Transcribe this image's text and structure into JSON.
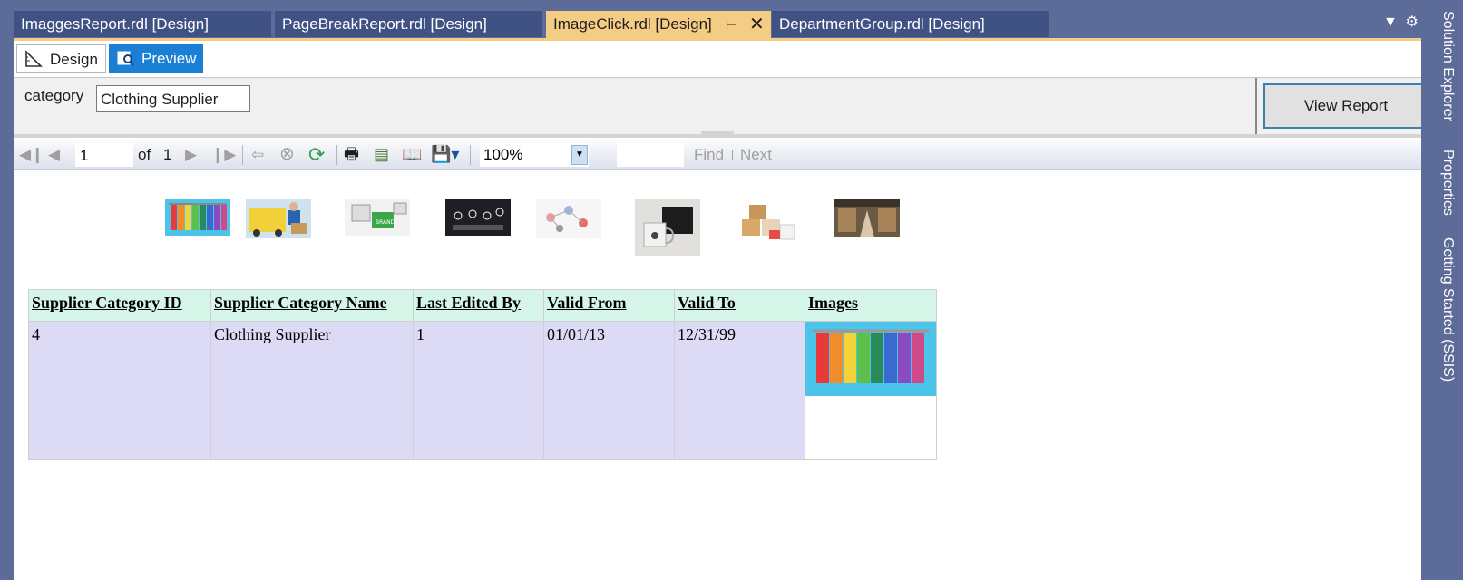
{
  "doc_tabs": [
    {
      "label": "ImaggesReport.rdl [Design]"
    },
    {
      "label": "PageBreakReport.rdl [Design]"
    },
    {
      "label": "ImageClick.rdl [Design]",
      "active": true
    },
    {
      "label": "DepartmentGroup.rdl [Design]"
    }
  ],
  "mode_tabs": {
    "design": "Design",
    "preview": "Preview"
  },
  "parameters": {
    "label": "category",
    "value": "Clothing Supplier"
  },
  "view_report": "View Report",
  "toolbar": {
    "page": "1",
    "of_label": "of",
    "total_pages": "1",
    "zoom": "100%",
    "find": "Find",
    "next": "Next"
  },
  "thumbnails": [
    "clothing-rack",
    "delivery-courier",
    "puzzle-piece",
    "tech-icons",
    "social-network",
    "mug-and-box",
    "packages",
    "warehouse"
  ],
  "table": {
    "headers": [
      "Supplier Category ID",
      "Supplier Category Name",
      "Last Edited By",
      "Valid From",
      "Valid To",
      "Images"
    ],
    "rows": [
      {
        "id": "4",
        "name": "Clothing Supplier",
        "edited_by": "1",
        "valid_from": "01/01/13",
        "valid_to": "12/31/99"
      }
    ]
  },
  "side_panels": [
    "Solution Explorer",
    "Properties",
    "Getting Started (SSIS)"
  ],
  "colors": {
    "accent_tab": "#f5cc84",
    "preview_tab": "#1a80d6",
    "header_bg": "#d5f5e8",
    "row_bg": "#dcdaf5"
  }
}
